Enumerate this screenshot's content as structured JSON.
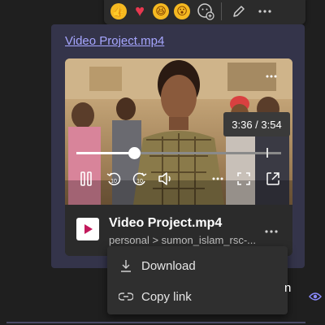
{
  "reactions": {
    "items": [
      {
        "name": "like",
        "glyph": "👍"
      },
      {
        "name": "heart",
        "glyph": "♥"
      },
      {
        "name": "laugh",
        "glyph": "😆"
      },
      {
        "name": "surprised",
        "glyph": "😮"
      }
    ]
  },
  "message": {
    "file_link": "Video Project.mp4"
  },
  "video": {
    "time_display": "3:36 / 3:54",
    "progress": 0.28,
    "buffered": 0.93
  },
  "file": {
    "name": "Video Project.mp4",
    "path": "personal > sumon_islam_rsc-..."
  },
  "menu": {
    "download_label": "Download",
    "copy_link_label": "Copy link"
  },
  "edge": {
    "cut_text": "n"
  },
  "colors": {
    "link": "#a6a6ff",
    "card": "#34344a",
    "accent": "#8a8aff"
  }
}
